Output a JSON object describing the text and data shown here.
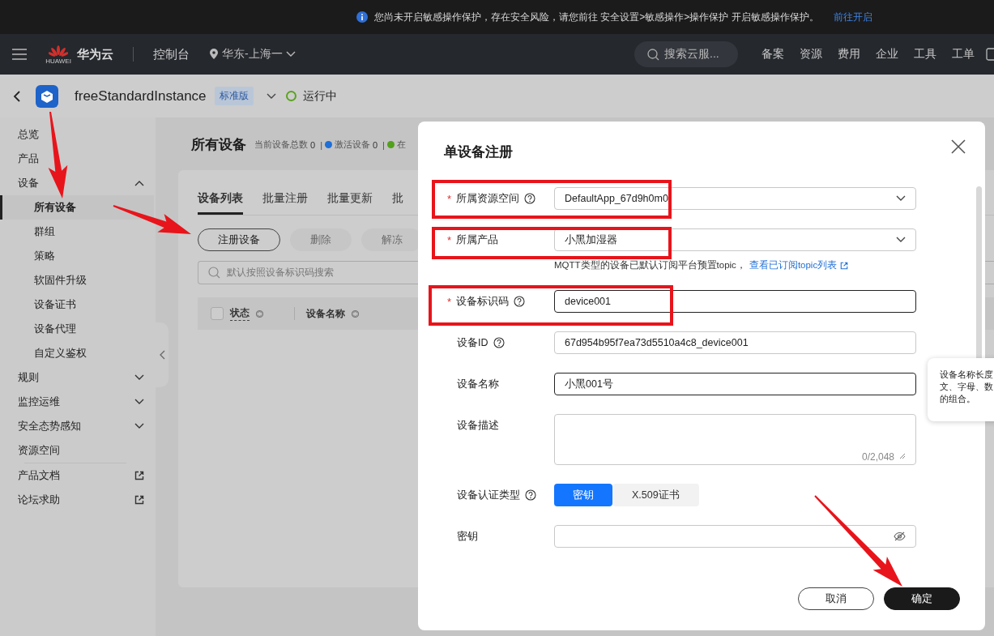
{
  "notice": {
    "text": "您尚未开启敏感操作保护，存在安全风险，请您前往 安全设置>敏感操作>操作保护 开启敏感操作保护。",
    "link": "前往开启"
  },
  "navbar": {
    "brand_mark": "HUAWEI",
    "brand": "华为云",
    "console": "控制台",
    "region": "华东-上海一",
    "search": {
      "placeholder": "搜索云服..."
    },
    "links": [
      "备案",
      "资源",
      "费用",
      "企业",
      "工具",
      "工单"
    ]
  },
  "instance": {
    "name": "freeStandardInstance",
    "edition": "标准版",
    "status": "运行中"
  },
  "sidebar": {
    "items": [
      {
        "label": "总览",
        "kind": "item",
        "selected": false
      },
      {
        "label": "产品",
        "kind": "item",
        "selected": false
      },
      {
        "label": "设备",
        "kind": "group",
        "expanded": true,
        "selected": false,
        "children": [
          {
            "label": "所有设备",
            "selected": true
          },
          {
            "label": "群组",
            "selected": false
          },
          {
            "label": "策略",
            "selected": false
          },
          {
            "label": "软固件升级",
            "selected": false
          },
          {
            "label": "设备证书",
            "selected": false
          },
          {
            "label": "设备代理",
            "selected": false
          },
          {
            "label": "自定义鉴权",
            "selected": false
          }
        ]
      },
      {
        "label": "规则",
        "kind": "group",
        "expanded": false,
        "selected": false
      },
      {
        "label": "监控运维",
        "kind": "group",
        "expanded": false,
        "selected": false
      },
      {
        "label": "安全态势感知",
        "kind": "group",
        "expanded": false,
        "selected": false
      },
      {
        "label": "资源空间",
        "kind": "item",
        "selected": false
      },
      {
        "label": "产品文档",
        "kind": "external",
        "selected": false
      },
      {
        "label": "论坛求助",
        "kind": "external",
        "selected": false
      }
    ]
  },
  "page": {
    "title": "所有设备",
    "stats": [
      {
        "label": "当前设备总数",
        "value": "0"
      },
      {
        "sep": "|",
        "label": "激活设备",
        "value": "0",
        "color": "#1f6fd6"
      },
      {
        "sep": "|",
        "label": "在",
        "color": "#52a01c"
      }
    ],
    "tabs": [
      {
        "label": "设备列表",
        "selected": true
      },
      {
        "label": "批量注册",
        "selected": false
      },
      {
        "label": "批量更新",
        "selected": false
      },
      {
        "label": "批",
        "selected": false
      }
    ],
    "actions": [
      {
        "label": "注册设备",
        "disabled": false
      },
      {
        "label": "删除",
        "disabled": true
      },
      {
        "label": "解冻",
        "disabled": true
      }
    ],
    "search": {
      "placeholder": "默认按照设备标识码搜索"
    },
    "table": {
      "select_all": {
        "checked": false
      },
      "columns": [
        {
          "label": "状态",
          "sortable": true,
          "dashed": true
        },
        {
          "label": "设备名称",
          "sortable": true,
          "dashed": false
        }
      ]
    }
  },
  "dialog": {
    "title": "单设备注册",
    "fields": [
      {
        "kind": "select",
        "required_mark": "*",
        "label": "所属资源空间",
        "help": true,
        "value": "DefaultApp_67d9h0m0",
        "focused": false
      },
      {
        "kind": "select",
        "required_mark": "*",
        "label": "所属产品",
        "help": false,
        "value": "小黑加湿器",
        "focused": false,
        "note": "MQTT类型的设备已默认订阅平台预置topic，",
        "note_link": "查看已订阅topic列表"
      },
      {
        "kind": "text",
        "required_mark": "*",
        "label": "设备标识码",
        "help": true,
        "value": "device001",
        "focused": true
      },
      {
        "kind": "text",
        "label": "设备ID",
        "help": true,
        "value": "67d954b95f7ea73d5510a4c8_device001",
        "focused": false
      },
      {
        "kind": "text",
        "label": "设备名称",
        "help": false,
        "value": "小黑001号",
        "focused": true
      },
      {
        "kind": "textarea",
        "label": "设备描述",
        "help": false,
        "counter": "0/2,048",
        "focused": false
      },
      {
        "kind": "toggle",
        "label": "设备认证类型",
        "help": true,
        "options": [
          {
            "label": "密钥",
            "selected": true
          },
          {
            "label": "X.509证书",
            "selected": false
          }
        ]
      },
      {
        "kind": "password",
        "label": "密钥",
        "help": false,
        "focused": false
      }
    ],
    "buttons": [
      {
        "label": "取消",
        "primary": false
      },
      {
        "label": "确定",
        "primary": true
      }
    ]
  },
  "tooltip": {
    "lines": [
      "设备名称长度",
      "文、字母、数",
      "的组合。"
    ]
  }
}
